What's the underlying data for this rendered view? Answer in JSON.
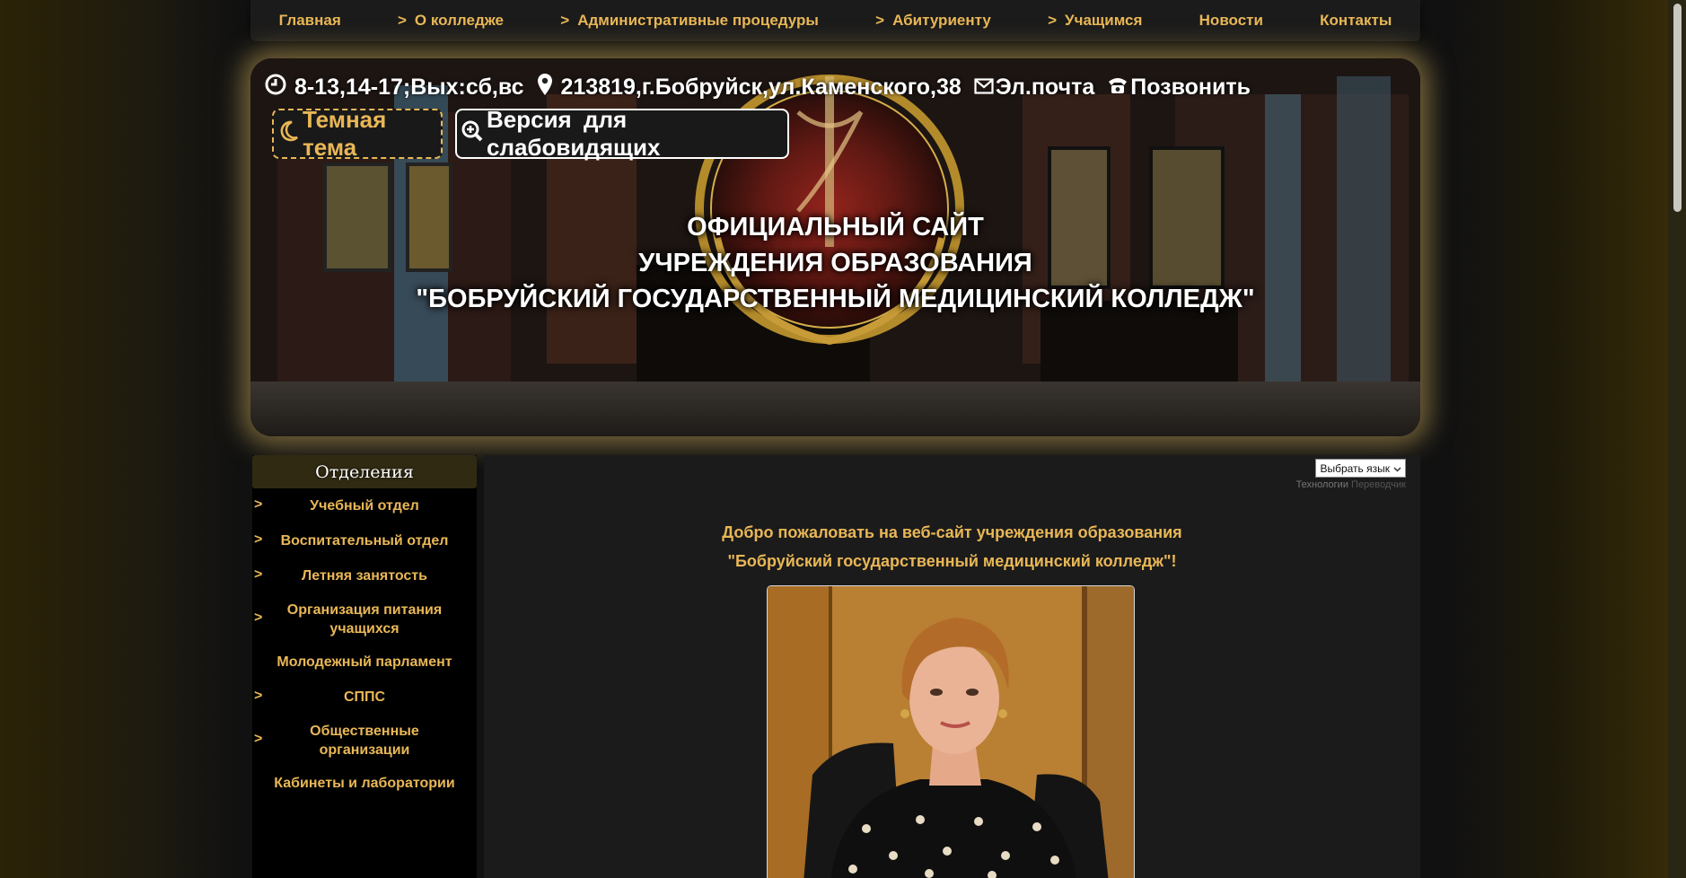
{
  "nav": {
    "items": [
      {
        "label": "Главная",
        "arrow": false
      },
      {
        "label": "О колледже",
        "arrow": true
      },
      {
        "label": "Административные процедуры",
        "arrow": true
      },
      {
        "label": "Абитуриенту",
        "arrow": true
      },
      {
        "label": "Учащимся",
        "arrow": true
      },
      {
        "label": "Новости",
        "arrow": false
      },
      {
        "label": "Контакты",
        "arrow": false
      }
    ],
    "arrow_char": ">"
  },
  "header": {
    "hours": "8-13,14-17;Вых:сб,вс",
    "address": "213819,г.Бобруйск,ул.Каменского,38",
    "email": "Эл.почта",
    "call": "Позвонить",
    "dark_theme": "Темная тема",
    "low_vision": "Версия для слабовидящих",
    "title_lines": [
      "ОФИЦИАЛЬНЫЙ САЙТ",
      "УЧРЕЖДЕНИЯ ОБРАЗОВАНИЯ",
      "\"БОБРУЙСКИЙ ГОСУДАРСТВЕННЫЙ МЕДИЦИНСКИЙ КОЛЛЕДЖ\""
    ],
    "icons": [
      "clock-icon",
      "map-pin-icon",
      "mail-icon",
      "phone-icon",
      "moon-icon",
      "zoom-icon"
    ]
  },
  "sidebar": {
    "heading": "Отделения",
    "items": [
      {
        "label": "Учебный отдел",
        "arrow": true
      },
      {
        "label": "Воспитательный отдел",
        "arrow": true
      },
      {
        "label": "Летняя занятость",
        "arrow": true
      },
      {
        "label": "Организация питания учащихся",
        "arrow": true
      },
      {
        "label": "Молодежный парламент",
        "arrow": false
      },
      {
        "label": "СППС",
        "arrow": true
      },
      {
        "label": "Общественные организации",
        "arrow": true
      },
      {
        "label": "Кабинеты и лаборатории",
        "arrow": false
      }
    ]
  },
  "translate": {
    "select_label": "Выбрать язык",
    "powered_prefix": "Технологии",
    "powered_link": "Переводчик"
  },
  "main": {
    "welcome_line1": "Добро пожаловать на веб-сайт учреждения образования",
    "welcome_line2": "\"Бобруйский государственный медицинский колледж\"!"
  },
  "colors": {
    "accent": "#e9b756",
    "nav_bg": "#1b1b1b",
    "content_bg": "#1b1b1b",
    "sidebar_bg": "#000000"
  }
}
